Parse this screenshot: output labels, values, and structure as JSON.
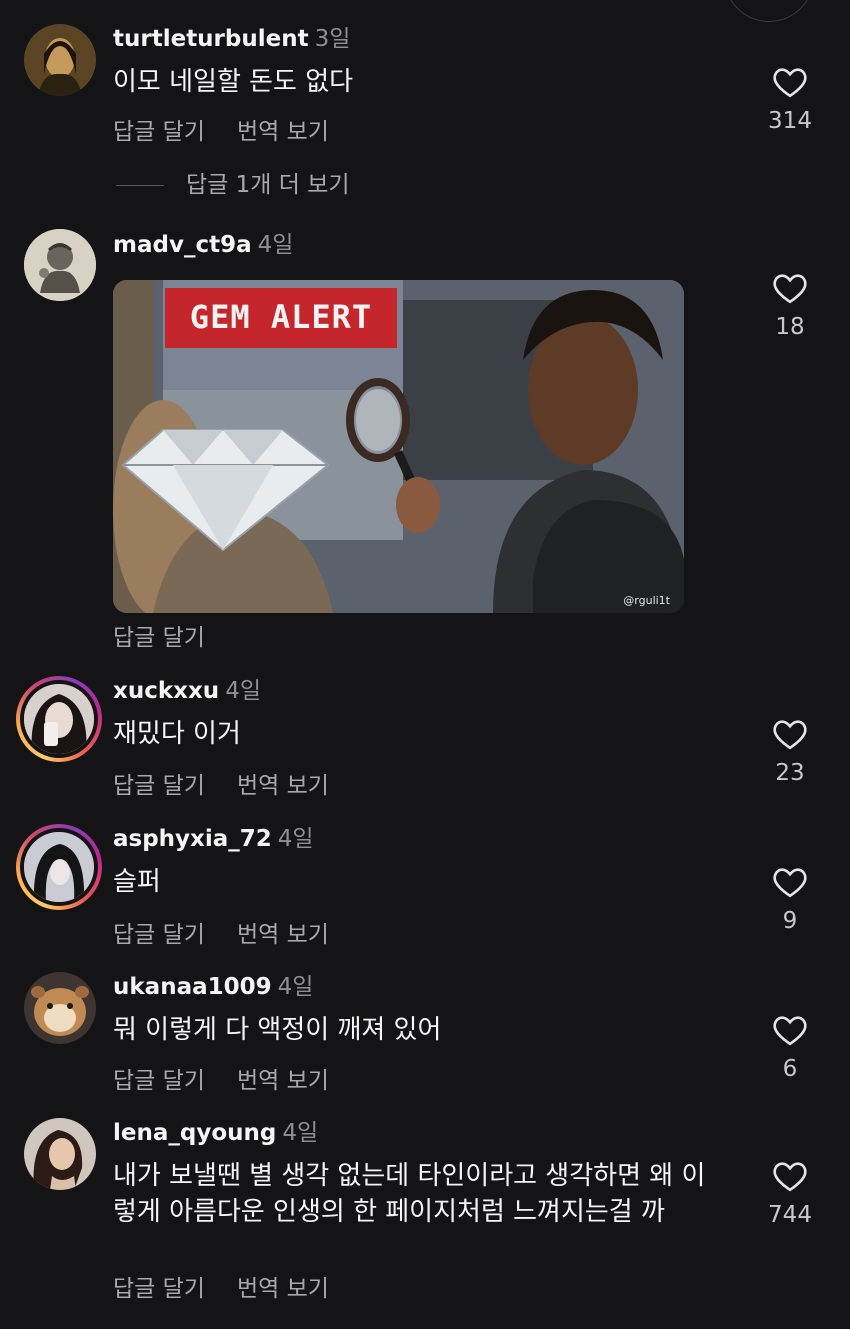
{
  "colors": {
    "background": "#141417",
    "muted": "#a8a8ad",
    "time": "#8e8e93"
  },
  "comments": [
    {
      "username": "turtleturbulent",
      "time": "3일",
      "text": "이모 네일할 돈도 없다",
      "reply": "답글 달기",
      "translate": "번역 보기",
      "likes": "314",
      "more_replies": "답글 1개 더 보기"
    },
    {
      "username": "madv_ct9a",
      "time": "4일",
      "reply": "답글 달기",
      "likes": "18",
      "gif": {
        "banner": "GEM ALERT",
        "watermark": "@rguli1t"
      }
    },
    {
      "username": "xuckxxu",
      "time": "4일",
      "text": "재밌다 이거",
      "reply": "답글 달기",
      "translate": "번역 보기",
      "likes": "23"
    },
    {
      "username": "asphyxia_72",
      "time": "4일",
      "text": "슬퍼",
      "reply": "답글 달기",
      "translate": "번역 보기",
      "likes": "9"
    },
    {
      "username": "ukanaa1009",
      "time": "4일",
      "text": "뭐 이렇게 다 액정이 깨져 있어",
      "reply": "답글 달기",
      "translate": "번역 보기",
      "likes": "6"
    },
    {
      "username": "lena_qyoung",
      "time": "4일",
      "text": "내가 보낼땐 별 생각 없는데 타인이라고 생각하면 왜 이렇게 아름다운 인생의 한 페이지처럼 느껴지는걸 까",
      "reply": "답글 달기",
      "translate": "번역 보기",
      "likes": "744"
    }
  ],
  "icons": {
    "like": "heart-outline-icon"
  }
}
